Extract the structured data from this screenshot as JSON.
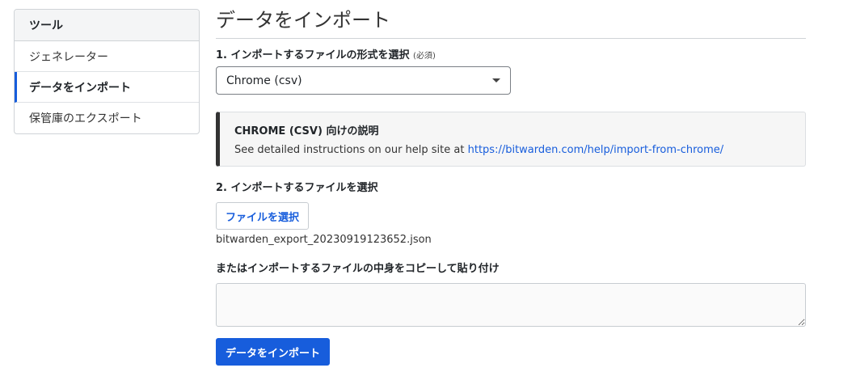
{
  "sidebar": {
    "header": "ツール",
    "items": [
      {
        "label": "ジェネレーター",
        "active": false
      },
      {
        "label": "データをインポート",
        "active": true
      },
      {
        "label": "保管庫のエクスポート",
        "active": false
      }
    ]
  },
  "main": {
    "title": "データをインポート",
    "format_label": "1. インポートするファイルの形式を選択",
    "required_label": "(必須)",
    "format_selected": "Chrome (csv)",
    "callout": {
      "title": "CHROME (CSV) 向けの説明",
      "body": "See detailed instructions on our help site at",
      "link": "https://bitwarden.com/help/import-from-chrome/"
    },
    "file_label": "2. インポートするファイルを選択",
    "file_button": "ファイルを選択",
    "file_name": "bitwarden_export_20230919123652.json",
    "paste_label": "またはインポートするファイルの中身をコピーして貼り付け",
    "paste_value": "",
    "submit_label": "データをインポート"
  },
  "colors": {
    "accent": "#175ddc",
    "callout_border": "#333333"
  }
}
